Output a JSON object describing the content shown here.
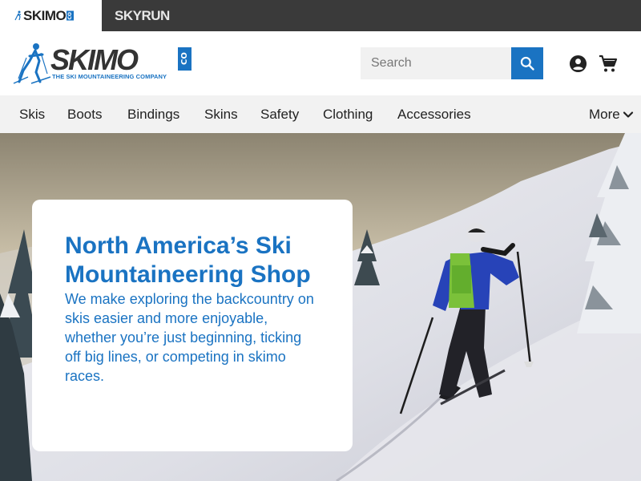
{
  "brandbar": {
    "tabs": [
      {
        "label": "SKIMO",
        "badge": "CO"
      },
      {
        "label": "SKYRUN"
      }
    ]
  },
  "header": {
    "logo": {
      "word": "SKIMO",
      "badge": "CO",
      "tagline": "THE SKI MOUNTAINEERING COMPANY"
    },
    "search": {
      "placeholder": "Search",
      "value": ""
    },
    "icons": {
      "search": "search-icon",
      "account": "account-circle-icon",
      "cart": "shopping-cart-icon"
    }
  },
  "nav": {
    "items": [
      "Skis",
      "Boots",
      "Bindings",
      "Skins",
      "Safety",
      "Clothing",
      "Accessories"
    ],
    "more_label": "More"
  },
  "hero": {
    "title": "North America’s Ski Mountaineering Shop",
    "description": "We make exploring the backcountry on skis easier and more enjoyable, whether you’re just beginning, ticking off big lines, or competing in skimo races."
  },
  "colors": {
    "brand_blue": "#1a73c2",
    "topbar": "#3a3a3a",
    "nav_bg": "#f2f2f2"
  }
}
